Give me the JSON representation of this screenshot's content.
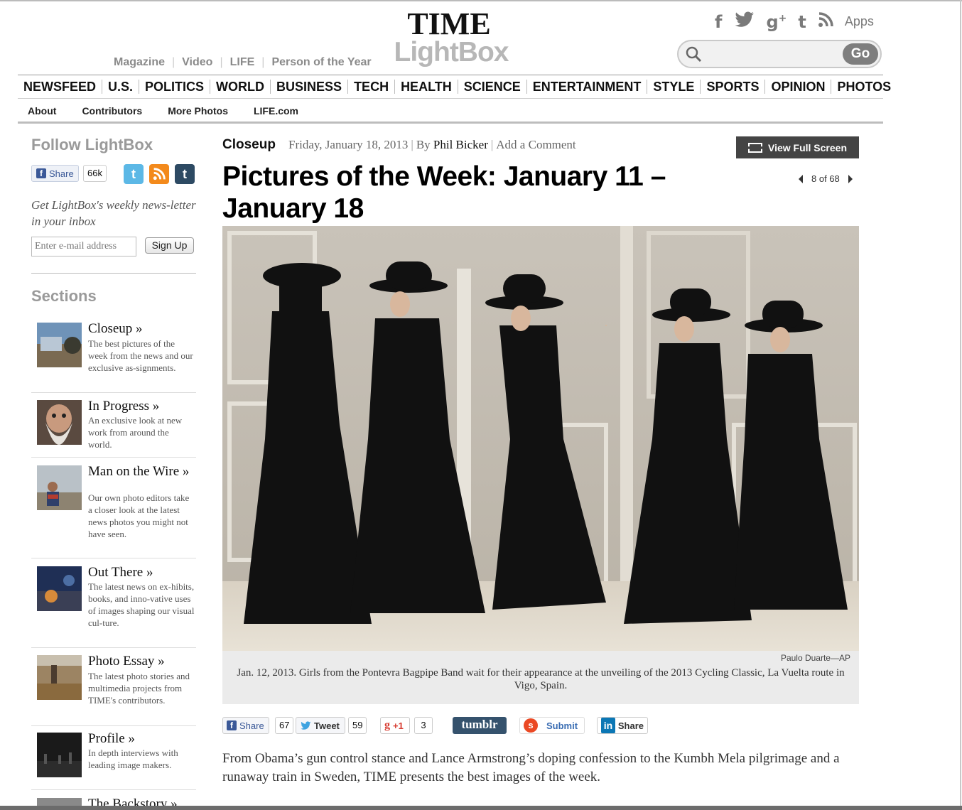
{
  "brand": {
    "time": "TIME",
    "lightbox": "LightBox"
  },
  "toplinks": [
    "Magazine",
    "Video",
    "LIFE",
    "Person of the Year"
  ],
  "social": {
    "icons": [
      "facebook-icon",
      "twitter-icon",
      "google-plus-icon",
      "tumblr-icon",
      "rss-icon"
    ],
    "apps_label": "Apps"
  },
  "search": {
    "placeholder": "",
    "go_label": "Go"
  },
  "mainnav": [
    "NEWSFEED",
    "U.S.",
    "POLITICS",
    "WORLD",
    "BUSINESS",
    "TECH",
    "HEALTH",
    "SCIENCE",
    "ENTERTAINMENT",
    "STYLE",
    "SPORTS",
    "OPINION",
    "PHOTOS"
  ],
  "subnav": [
    "About",
    "Contributors",
    "More Photos",
    "LIFE.com"
  ],
  "sidebar": {
    "follow_title": "Follow LightBox",
    "share_label": "Share",
    "share_count": "66k",
    "newsletter_text": "Get LightBox's weekly news-letter in your inbox",
    "email_placeholder": "Enter e-mail address",
    "signup_label": "Sign Up",
    "sections_title": "Sections",
    "sections": [
      {
        "name": "Closeup »",
        "desc": "The best pictures of the week from the news and our exclusive as-signments."
      },
      {
        "name": "In Progress »",
        "desc": "An exclusive look at new work from around the world."
      },
      {
        "name": "Man on the Wire »",
        "desc": "Our own photo editors take a closer look at the latest news photos you might not have seen."
      },
      {
        "name": "Out There »",
        "desc": "The latest news on ex-hibits, books, and inno-vative uses of images shaping our visual cul-ture."
      },
      {
        "name": "Photo Essay »",
        "desc": "The latest photo stories and multimedia projects from TIME's contributors."
      },
      {
        "name": "Profile »",
        "desc": "In depth interviews with leading image makers."
      },
      {
        "name": "The Backstory »",
        "desc": ""
      }
    ]
  },
  "article": {
    "kicker": "Closeup",
    "date": "Friday, January 18, 2013",
    "by": "By",
    "author": "Phil Bicker",
    "comment_link": "Add a Comment",
    "fullscreen_label": "View Full Screen",
    "headline": "Pictures of the Week: January 11 – January 18",
    "pager": "8 of 68",
    "photo_credit": "Paulo Duarte—AP",
    "caption": "Jan. 12, 2013. Girls from the Pontevra Bagpipe Band wait for their appearance at the unveiling of the 2013 Cycling Classic, La Vuelta route in Vigo, Spain.",
    "intro": "From Obama’s gun control stance and Lance Armstrong’s doping confession to the Kumbh Mela pilgrimage and a runaway train in Sweden, TIME presents the best images of the week."
  },
  "sharebar": {
    "fb_label": "Share",
    "fb_count": "67",
    "tweet_label": "Tweet",
    "tweet_count": "59",
    "gplus_label": "+1",
    "gplus_count": "3",
    "tumblr_label": "tumblr",
    "submit_label": "Submit",
    "linkedin_label": "Share"
  }
}
